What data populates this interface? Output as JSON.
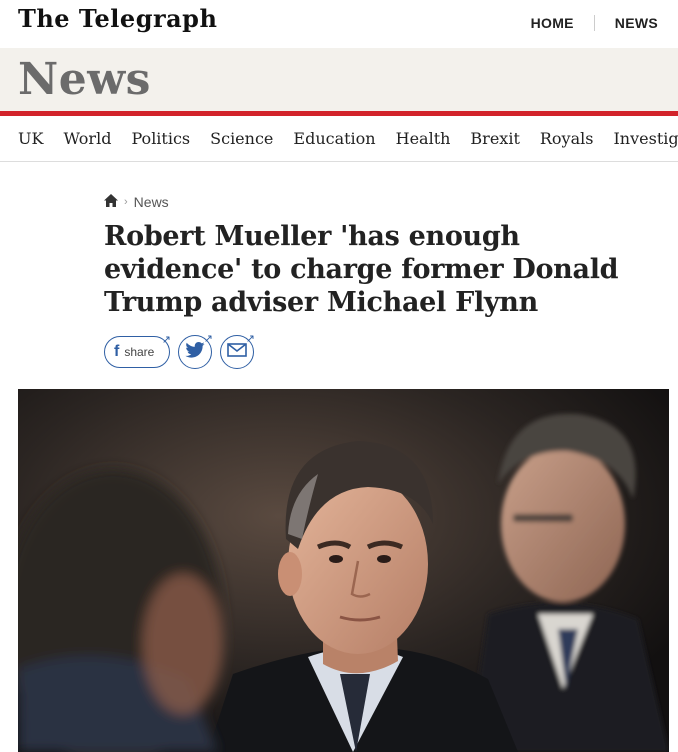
{
  "brand": {
    "logo": "The Telegraph"
  },
  "top_nav": {
    "home": "HOME",
    "news": "NEWS"
  },
  "section": {
    "title": "News"
  },
  "section_nav": [
    "UK",
    "World",
    "Politics",
    "Science",
    "Education",
    "Health",
    "Brexit",
    "Royals",
    "Investiga"
  ],
  "breadcrumb": {
    "home_icon": "home-icon",
    "current": "News"
  },
  "article": {
    "headline": "Robert Mueller 'has enough evidence' to charge former Donald Trump adviser Michael Flynn"
  },
  "share": {
    "facebook_label": "share",
    "facebook_glyph": "f",
    "ext_glyph": "↗"
  },
  "colors": {
    "accent_red": "#d2232a",
    "share_blue": "#2f5fa4",
    "banner_bg": "#f3f1ec"
  }
}
